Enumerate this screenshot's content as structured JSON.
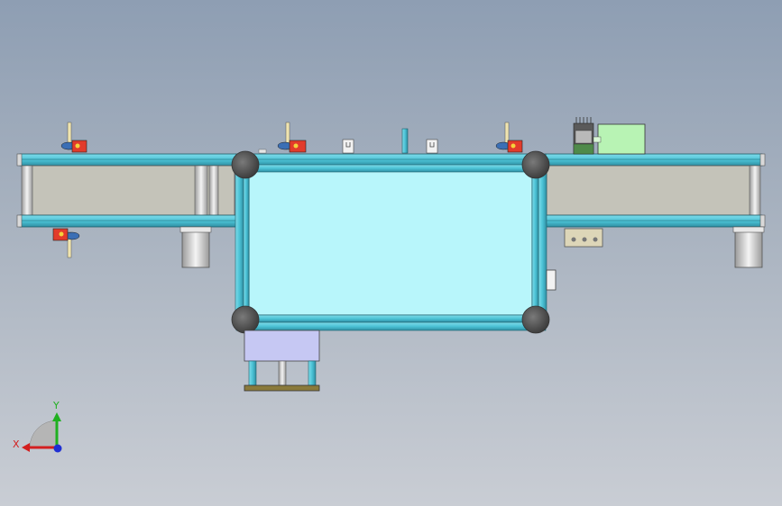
{
  "viewport": {
    "background_top": "#8e9eb3",
    "background_bottom": "#c9cdd4"
  },
  "colors": {
    "frame_profile": "#4cc3d6",
    "frame_profile_dark": "#2f8fa3",
    "glass_panel": "#b8f6fb",
    "belt": "#c4c3b9",
    "corner_joint": "#5f5f5f",
    "motor_housing": "#c6c8f3",
    "sensor_body": "#e23b2b",
    "terminal_box": "#b8f3b4",
    "base_plate": "#8a7a3c"
  },
  "triad": {
    "x_label": "X",
    "y_label": "Y",
    "x_color": "#d31f1f",
    "y_color": "#20b020",
    "z_color": "#1f2fd3"
  }
}
